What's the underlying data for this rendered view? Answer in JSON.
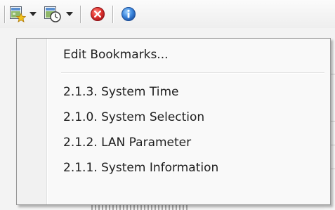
{
  "toolbar": {
    "buttons": [
      {
        "icon": "bookmark-star-icon",
        "has_dropdown": true
      },
      {
        "icon": "history-clock-icon",
        "has_dropdown": true
      },
      {
        "icon": "stop-icon",
        "has_dropdown": false
      },
      {
        "icon": "info-icon",
        "has_dropdown": false
      }
    ]
  },
  "colors": {
    "stop_red": "#d9302c",
    "info_blue": "#2f7ed8",
    "star_yellow": "#f2c21b",
    "menu_background": "#f9f9f9",
    "menu_border": "#979797"
  },
  "menu": {
    "edit_label": "Edit Bookmarks...",
    "bookmarks": [
      "2.1.3. System Time",
      "2.1.0. System Selection",
      "2.1.2. LAN Parameter",
      "2.1.1. System Information"
    ]
  }
}
